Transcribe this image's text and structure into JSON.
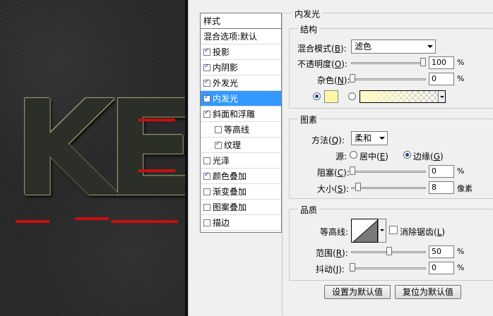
{
  "canvas": {
    "text": "KE"
  },
  "styles_panel": {
    "header": "样式",
    "items": [
      {
        "label": "混合选项:默认",
        "checkbox": false,
        "checked": false,
        "indent": false,
        "selected": false
      },
      {
        "label": "投影",
        "checkbox": true,
        "checked": true,
        "indent": false,
        "selected": false
      },
      {
        "label": "内阴影",
        "checkbox": true,
        "checked": true,
        "indent": false,
        "selected": false
      },
      {
        "label": "外发光",
        "checkbox": true,
        "checked": true,
        "indent": false,
        "selected": false
      },
      {
        "label": "内发光",
        "checkbox": true,
        "checked": true,
        "indent": false,
        "selected": true
      },
      {
        "label": "斜面和浮雕",
        "checkbox": true,
        "checked": true,
        "indent": false,
        "selected": false
      },
      {
        "label": "等高线",
        "checkbox": true,
        "checked": false,
        "indent": true,
        "selected": false
      },
      {
        "label": "纹理",
        "checkbox": true,
        "checked": true,
        "indent": true,
        "selected": false
      },
      {
        "label": "光泽",
        "checkbox": true,
        "checked": false,
        "indent": false,
        "selected": false
      },
      {
        "label": "颜色叠加",
        "checkbox": true,
        "checked": true,
        "indent": false,
        "selected": false
      },
      {
        "label": "渐变叠加",
        "checkbox": true,
        "checked": false,
        "indent": false,
        "selected": false
      },
      {
        "label": "图案叠加",
        "checkbox": true,
        "checked": false,
        "indent": false,
        "selected": false
      },
      {
        "label": "描边",
        "checkbox": true,
        "checked": false,
        "indent": false,
        "selected": false
      }
    ]
  },
  "inner_glow": {
    "title": "内发光",
    "structure": {
      "title": "结构",
      "blend_mode": {
        "label": "混合模式",
        "key": "B",
        "value": "滤色"
      },
      "opacity": {
        "label": "不透明度",
        "key": "O",
        "value": "100",
        "unit": "%",
        "fraction": 1.0
      },
      "noise": {
        "label": "杂色",
        "key": "N",
        "value": "0",
        "unit": "%",
        "fraction": 0.0
      },
      "color_swatch": "#fff7a6"
    },
    "elements": {
      "title": "图素",
      "technique": {
        "label": "方法",
        "key": "Q",
        "value": "柔和"
      },
      "source": {
        "label": "源:",
        "center_label": "居中",
        "center_key": "E",
        "edge_label": "边缘",
        "edge_key": "G"
      },
      "choke": {
        "label": "阻塞",
        "key": "C",
        "value": "0",
        "unit": "%",
        "fraction": 0.0
      },
      "size": {
        "label": "大小",
        "key": "S",
        "value": "8",
        "unit": "像素",
        "fraction": 0.06
      }
    },
    "quality": {
      "title": "品质",
      "contour_label": "等高线:",
      "antialias": {
        "label": "消除锯齿",
        "key": "L",
        "checked": false
      },
      "range": {
        "label": "范围",
        "key": "R",
        "value": "50",
        "unit": "%",
        "fraction": 0.5
      },
      "jitter": {
        "label": "抖动",
        "key": "J",
        "value": "0",
        "unit": "%",
        "fraction": 0.0
      }
    },
    "buttons": {
      "make_default": "设置为默认值",
      "reset_default": "复位为默认值"
    }
  }
}
